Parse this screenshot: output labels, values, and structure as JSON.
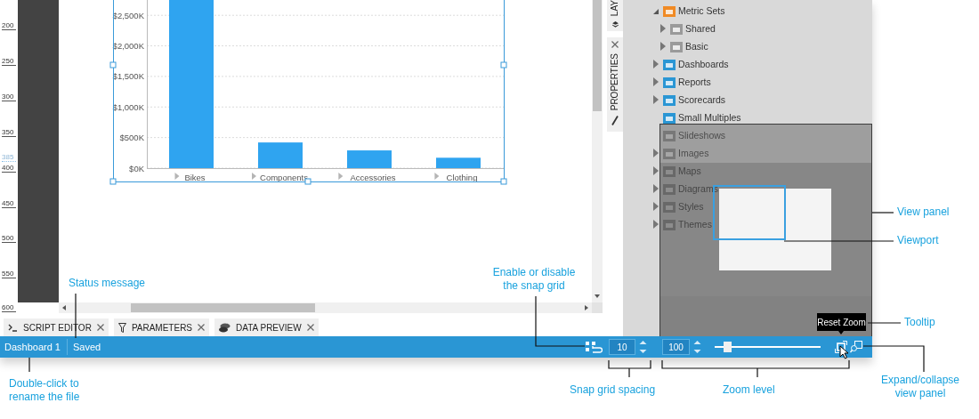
{
  "ruler": {
    "labels": [
      {
        "text": "200",
        "kind": "tick"
      },
      {
        "text": "250",
        "kind": "tick"
      },
      {
        "text": "300",
        "kind": "tick"
      },
      {
        "text": "350",
        "kind": "tick"
      },
      {
        "text": "385",
        "kind": "marker"
      },
      {
        "text": "400",
        "kind": "tick"
      },
      {
        "text": "450",
        "kind": "tick"
      },
      {
        "text": "500",
        "kind": "tick"
      },
      {
        "text": "550",
        "kind": "tick"
      },
      {
        "text": "600",
        "kind": "tick"
      }
    ]
  },
  "chart": {
    "chart_data": {
      "type": "bar",
      "categories": [
        "Bikes",
        "Components",
        "Accessories",
        "Clothing"
      ],
      "values": [
        2750,
        420,
        290,
        170
      ],
      "ylim": [
        0,
        2750
      ],
      "grid": true,
      "yticks": [
        {
          "value": 0,
          "label": "$0K"
        },
        {
          "value": 500,
          "label": "$500K"
        },
        {
          "value": 1000,
          "label": "$1,000K"
        },
        {
          "value": 1500,
          "label": "$1,500K"
        },
        {
          "value": 2000,
          "label": "$2,000K"
        },
        {
          "value": 2500,
          "label": "$2,500K"
        }
      ]
    }
  },
  "side_tabs": [
    {
      "label": "LAY"
    },
    {
      "label": "PROPERTIES"
    }
  ],
  "tree": [
    {
      "label": "Metric Sets",
      "expanded": true,
      "color": "#f08a24",
      "children": [
        {
          "label": "Shared",
          "expanded": false,
          "color": "#9a9a9a"
        },
        {
          "label": "Basic",
          "expanded": false,
          "color": "#9a9a9a"
        }
      ]
    },
    {
      "label": "Dashboards",
      "expanded": false,
      "color": "#2a96d4"
    },
    {
      "label": "Reports",
      "expanded": false,
      "color": "#2a96d4"
    },
    {
      "label": "Scorecards",
      "expanded": false,
      "color": "#2a96d4"
    },
    {
      "label": "Small Multiples",
      "color": "#2a96d4"
    },
    {
      "label": "Slideshows"
    },
    {
      "label": "Images",
      "expanded": false
    },
    {
      "label": "Maps",
      "expanded": false
    },
    {
      "label": "Diagrams",
      "expanded": false
    },
    {
      "label": "Styles",
      "expanded": false
    },
    {
      "label": "Themes",
      "expanded": false
    }
  ],
  "tooltip": "Reset Zoom",
  "bottom_tabs": [
    {
      "label": "SCRIPT EDITOR"
    },
    {
      "label": "PARAMETERS"
    },
    {
      "label": "DATA PREVIEW"
    }
  ],
  "status_bar": {
    "file_name": "Dashboard 1",
    "message": "Saved",
    "snap_spacing": "10",
    "zoom": "100",
    "zoom_slider": {
      "level": 0.12
    }
  },
  "annotations": [
    {
      "text": "View panel"
    },
    {
      "text": "Viewport"
    },
    {
      "text": "Status message"
    },
    {
      "text": "Enable or disable the snap grid"
    },
    {
      "text": "Tooltip"
    },
    {
      "text": "Double-click to rename the file"
    },
    {
      "text": "Snap grid spacing"
    },
    {
      "text": "Zoom level"
    },
    {
      "text": "Expand/collapse view panel"
    }
  ]
}
